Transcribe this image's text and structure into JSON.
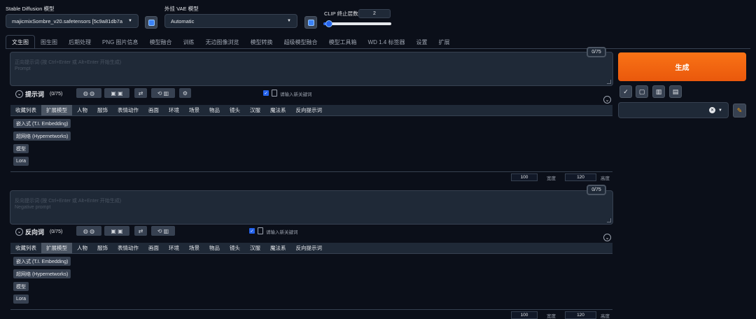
{
  "header": {
    "model_label": "Stable Diffusion 模型",
    "model_value": "majicmixSombre_v20.safetensors [5c9a81db7a",
    "vae_label": "外挂 VAE 模型",
    "vae_value": "Automatic",
    "clip_label": "CLIP 终止层数",
    "clip_value": "2",
    "clip_slider_fraction": 0.08
  },
  "tabs": [
    "文生图",
    "图生图",
    "后期处理",
    "PNG 图片信息",
    "模型融合",
    "训练",
    "无边图像浏览",
    "模型转换",
    "超级模型融合",
    "模型工具箱",
    "WD 1.4 标签器",
    "设置",
    "扩展"
  ],
  "active_tab": 0,
  "prompt": {
    "placeholder_cn": "正向提示词 (按 Ctrl+Enter 或 Alt+Enter 开始生成)",
    "placeholder_en": "Prompt",
    "count": "0/75",
    "section_title": "提示词",
    "section_count": "(0/75)",
    "keyword_placeholder": "请输入新关键词"
  },
  "negative": {
    "placeholder_cn": "反向提示词 (按 Ctrl+Enter 或 Alt+Enter 开始生成)",
    "placeholder_en": "Negative prompt",
    "count": "0/75",
    "section_title": "反向词",
    "section_count": "(0/75)",
    "keyword_placeholder": "请输入新关键词"
  },
  "categories": [
    "收藏列表",
    "扩展模型",
    "人物",
    "服饰",
    "表情动作",
    "画面",
    "环境",
    "场景",
    "物品",
    "镜头",
    "汉服",
    "魔法系",
    "反向提示词"
  ],
  "active_category": 1,
  "extension_items": [
    "嵌入式 (T.I. Embedding)",
    "超网络 (Hypernetworks)",
    "模型",
    "Lora"
  ],
  "size": {
    "width": "100",
    "width_label": "宽度",
    "height": "120",
    "height_label": "高度"
  },
  "generate_label": "生成",
  "icons": {
    "refresh": "refresh-icon",
    "check": "check-icon",
    "stop": "stop-icon",
    "trash": "trash-icon",
    "clipboard": "clipboard-icon",
    "pencil": "pencil-icon"
  },
  "colors": {
    "background": "#0b0f19",
    "generate_start": "#f97316",
    "generate_end": "#ea580c",
    "accent_blue": "#3b82f6"
  }
}
